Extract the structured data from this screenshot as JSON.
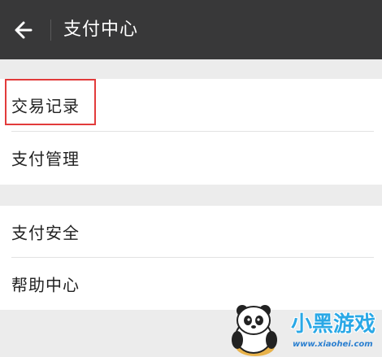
{
  "header": {
    "title": "支付中心",
    "back_icon": "arrow-left-icon",
    "background": "#383839"
  },
  "groups": [
    {
      "items": [
        {
          "label": "交易记录",
          "highlighted": true
        },
        {
          "label": "支付管理"
        }
      ]
    },
    {
      "items": [
        {
          "label": "支付安全"
        },
        {
          "label": "帮助中心"
        }
      ]
    }
  ],
  "highlight_color": "#e23b3b",
  "watermark": {
    "brand": "小黑游戏",
    "url": "www.xiaohei.com"
  }
}
